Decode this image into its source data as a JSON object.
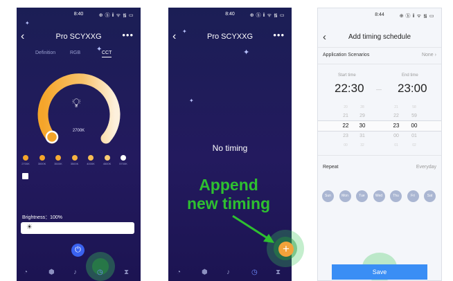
{
  "panel1": {
    "time": "8:40",
    "status_icons": "⊕ ⓑ ⅱ ᯤ ᯾ ▭",
    "title": "Pro SCYXXG",
    "more": "•••",
    "tabs": [
      "Definition",
      "RGB",
      "CCT"
    ],
    "active_tab": "CCT",
    "temperature_label": "2700K",
    "presets": [
      {
        "label": "2700K",
        "color": "#f5a52a"
      },
      {
        "label": "3000K",
        "color": "#f5a52a"
      },
      {
        "label": "3500K",
        "color": "#f5aa35"
      },
      {
        "label": "3500K",
        "color": "#f6b240"
      },
      {
        "label": "4000K",
        "color": "#f7bd55"
      },
      {
        "label": "4500K",
        "color": "#f8cc74"
      },
      {
        "label": "5700K",
        "color": "#ffffff"
      }
    ],
    "brightness_label": "Brightness：100%",
    "brightness_fraction": 1.0
  },
  "panel2": {
    "time": "8:40",
    "status_icons": "⊕ ⓑ ⅱ ᯤ ᯾ ▭",
    "title": "Pro SCYXXG",
    "more": "•••",
    "empty_text": "No timing",
    "fab_label": "+"
  },
  "annotation": {
    "line1": "Append",
    "line2": "new timing",
    "color": "#2ec030"
  },
  "panel3": {
    "time": "8:44",
    "status_icons": "⊕ ⓑ ⅱ ᯤ ᯾ ▭",
    "title": "Add timing schedule",
    "application_label": "Application Scenarios",
    "application_value": "None",
    "start_label": "Start time",
    "start_value": "22:30",
    "end_label": "End time",
    "end_value": "23:00",
    "picker_columns": [
      [
        "20",
        "21",
        "22",
        "23",
        "00"
      ],
      [
        "28",
        "29",
        "30",
        "31",
        "32"
      ],
      [
        "21",
        "22",
        "23",
        "00",
        "01"
      ],
      [
        "58",
        "59",
        "00",
        "01",
        "02"
      ]
    ],
    "repeat_label": "Repeat",
    "repeat_value": "Everyday",
    "days": [
      "Sun",
      "Mon",
      "Tue",
      "Wed",
      "Thu",
      "Fri",
      "Sat"
    ],
    "save_label": "Save"
  },
  "colors": {
    "accent_blue": "#3a8ef5",
    "dark_bg": "#1f1a5c",
    "warm_orange": "#f5a52a",
    "highlight_green": "#2ec030"
  }
}
